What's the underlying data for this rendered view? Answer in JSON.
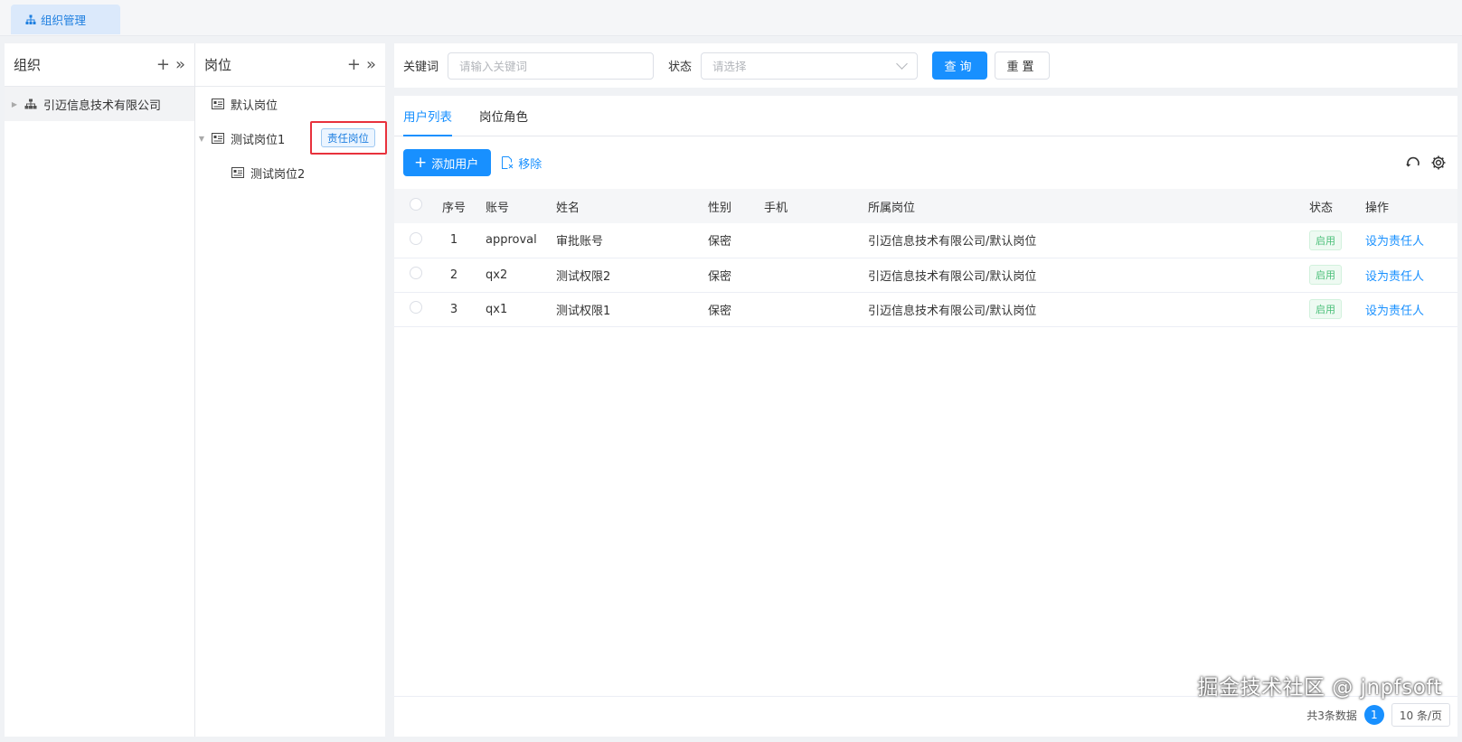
{
  "top_tab": {
    "label": "组织管理"
  },
  "org_panel": {
    "title": "组织",
    "tree": [
      {
        "label": "引迈信息技术有限公司"
      }
    ]
  },
  "post_panel": {
    "title": "岗位",
    "tree": [
      {
        "label": "默认岗位"
      },
      {
        "label": "测试岗位1",
        "tag": "责任岗位"
      },
      {
        "label": "测试岗位2"
      }
    ]
  },
  "search": {
    "keyword_label": "关键词",
    "keyword_placeholder": "请输入关键词",
    "status_label": "状态",
    "status_placeholder": "请选择",
    "query_label": "查询",
    "reset_label": "重置"
  },
  "tabs": [
    {
      "label": "用户列表"
    },
    {
      "label": "岗位角色"
    }
  ],
  "toolbar": {
    "add_label": "添加用户",
    "remove_label": "移除"
  },
  "table": {
    "headers": [
      "序号",
      "账号",
      "姓名",
      "性别",
      "手机",
      "所属岗位",
      "状态",
      "操作"
    ],
    "rows": [
      {
        "index": "1",
        "account": "approval",
        "name": "审批账号",
        "gender": "保密",
        "phone": "",
        "post": "引迈信息技术有限公司/默认岗位",
        "status": "启用",
        "action": "设为责任人"
      },
      {
        "index": "2",
        "account": "qx2",
        "name": "测试权限2",
        "gender": "保密",
        "phone": "",
        "post": "引迈信息技术有限公司/默认岗位",
        "status": "启用",
        "action": "设为责任人"
      },
      {
        "index": "3",
        "account": "qx1",
        "name": "测试权限1",
        "gender": "保密",
        "phone": "",
        "post": "引迈信息技术有限公司/默认岗位",
        "status": "启用",
        "action": "设为责任人"
      }
    ]
  },
  "footer": {
    "total_text": "共3条数据",
    "page": "1",
    "page_size": "10 条/页"
  },
  "watermark": "掘金技术社区 @ jnpfsoft",
  "colors": {
    "accent": "#1890ff",
    "highlight_box": "#e8313c",
    "status_green": "#4cc07a"
  }
}
